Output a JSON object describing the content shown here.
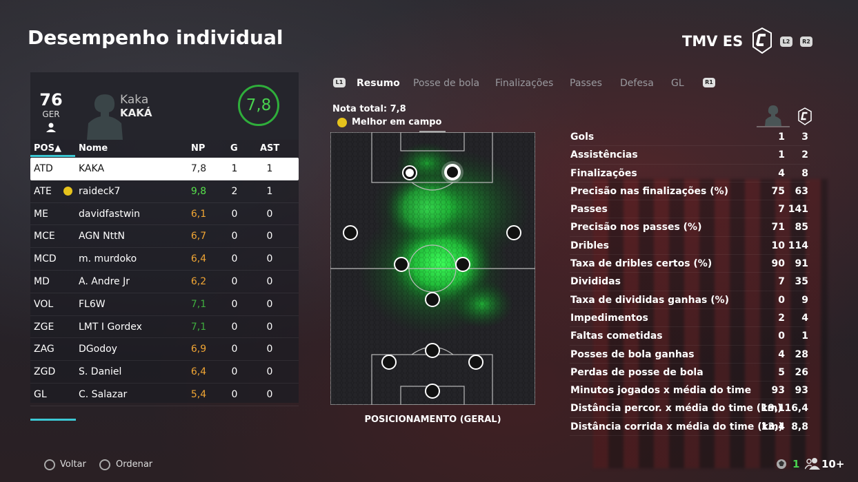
{
  "page_title": "Desempenho individual",
  "team": {
    "name": "TMV ES",
    "btn_l2": "L2",
    "btn_r2": "R2"
  },
  "player_card": {
    "overall": "76",
    "nationality": "GER",
    "gamertag": "Kaka",
    "name": "KAKÁ",
    "rating": "7,8"
  },
  "table": {
    "headers": {
      "pos": "POS▲",
      "name": "Nome",
      "np": "NP",
      "g": "G",
      "ast": "AST"
    },
    "rows": [
      {
        "pos": "ATD",
        "name": "KAKA",
        "np": "7,8",
        "g": "1",
        "ast": "1",
        "np_color": "#222222",
        "selected": true
      },
      {
        "pos": "ATE",
        "name": "raideck7",
        "np": "9,8",
        "g": "2",
        "ast": "1",
        "np_color": "#57e04b",
        "mom": true
      },
      {
        "pos": "ME",
        "name": "davidfastwin",
        "np": "6,1",
        "g": "0",
        "ast": "0",
        "np_color": "#f0a534"
      },
      {
        "pos": "MCE",
        "name": "AGN NttN",
        "np": "6,7",
        "g": "0",
        "ast": "0",
        "np_color": "#f0a534"
      },
      {
        "pos": "MCD",
        "name": "m. murdoko",
        "np": "6,4",
        "g": "0",
        "ast": "0",
        "np_color": "#f0a534"
      },
      {
        "pos": "MD",
        "name": "A. Andre Jr",
        "np": "6,2",
        "g": "0",
        "ast": "0",
        "np_color": "#f0a534"
      },
      {
        "pos": "VOL",
        "name": "FL6W",
        "np": "7,1",
        "g": "0",
        "ast": "0",
        "np_color": "#3fae3f"
      },
      {
        "pos": "ZGE",
        "name": "LMT I Gordex",
        "np": "7,1",
        "g": "0",
        "ast": "0",
        "np_color": "#3fae3f"
      },
      {
        "pos": "ZAG",
        "name": "DGodoy",
        "np": "6,9",
        "g": "0",
        "ast": "0",
        "np_color": "#f0a534"
      },
      {
        "pos": "ZGD",
        "name": "S. Daniel",
        "np": "6,4",
        "g": "0",
        "ast": "0",
        "np_color": "#f0a534"
      },
      {
        "pos": "GL",
        "name": "C. Salazar",
        "np": "5,4",
        "g": "0",
        "ast": "0",
        "np_color": "#f0a534"
      }
    ]
  },
  "tabs": {
    "left_btn": "L1",
    "right_btn": "R1",
    "items": [
      "Resumo",
      "Posse de bola",
      "Finalizações",
      "Passes",
      "Defesa",
      "GL"
    ]
  },
  "summary": {
    "nota_total": "Nota total: 7,8",
    "melhor": "Melhor em campo",
    "pitch_caption": "POSICIONAMENTO (GERAL)"
  },
  "stats": [
    {
      "label": "Gols",
      "player": "1",
      "team": "3"
    },
    {
      "label": "Assistências",
      "player": "1",
      "team": "2"
    },
    {
      "label": "Finalizações",
      "player": "4",
      "team": "8"
    },
    {
      "label": "Precisão nas finalizações (%)",
      "player": "75",
      "team": "63"
    },
    {
      "label": "Passes",
      "player": "7",
      "team": "141"
    },
    {
      "label": "Precisão nos passes (%)",
      "player": "71",
      "team": "85"
    },
    {
      "label": "Dribles",
      "player": "10",
      "team": "114"
    },
    {
      "label": "Taxa de dribles certos (%)",
      "player": "90",
      "team": "91"
    },
    {
      "label": "Divididas",
      "player": "7",
      "team": "35"
    },
    {
      "label": "Taxa de divididas ganhas (%)",
      "player": "0",
      "team": "9"
    },
    {
      "label": "Impedimentos",
      "player": "2",
      "team": "4"
    },
    {
      "label": "Faltas cometidas",
      "player": "0",
      "team": "1"
    },
    {
      "label": "Posses de bola ganhas",
      "player": "4",
      "team": "28"
    },
    {
      "label": "Perdas de posse de bola",
      "player": "5",
      "team": "26"
    },
    {
      "label": "Minutos jogados x média do time",
      "player": "93",
      "team": "93"
    },
    {
      "label": "Distância percor. x média do time (km)",
      "player": "19,1",
      "team": "16,4"
    },
    {
      "label": "Distância corrida x média do time (km)",
      "player": "13,4",
      "team": "8,8"
    }
  ],
  "footer": {
    "back": "Voltar",
    "sort": "Ordenar",
    "count": "1",
    "players": "10+"
  },
  "colors": {
    "accent": "#3cc8d4",
    "rating_green": "#49d14f",
    "mom_gold": "#e6c31c"
  }
}
